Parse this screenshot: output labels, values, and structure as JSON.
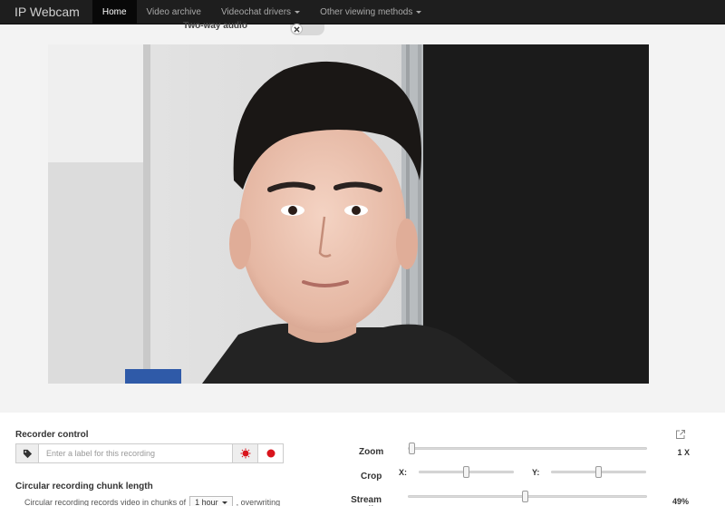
{
  "navbar": {
    "brand": "IP Webcam",
    "items": [
      {
        "label": "Home",
        "active": true,
        "dropdown": false
      },
      {
        "label": "Video archive",
        "active": false,
        "dropdown": false
      },
      {
        "label": "Videochat drivers",
        "active": false,
        "dropdown": true
      },
      {
        "label": "Other viewing methods",
        "active": false,
        "dropdown": true
      }
    ]
  },
  "audio": {
    "label": "Two-way audio",
    "enabled": false
  },
  "recorder": {
    "title": "Recorder control",
    "label_placeholder": "Enter a label for this recording",
    "tag_icon": "tag-icon",
    "buttons": [
      "motion-record-icon",
      "record-icon"
    ]
  },
  "chunk": {
    "title": "Circular recording chunk length",
    "text_before": "Circular recording records video in chunks of",
    "selected": "1 hour",
    "text_after": ", overwriting"
  },
  "controls": {
    "zoom": {
      "label": "Zoom",
      "value": "1 X",
      "level": 0.0
    },
    "crop": {
      "label": "Crop",
      "x_label": "X:",
      "y_label": "Y:",
      "x_level": 0.5,
      "y_level": 0.5
    },
    "quality": {
      "label": "Stream quality",
      "value": "49%",
      "level": 0.49
    }
  },
  "colors": {
    "navbar": "#1e1e1e",
    "record_red": "#d9141c",
    "background": "#f3f3f3"
  }
}
